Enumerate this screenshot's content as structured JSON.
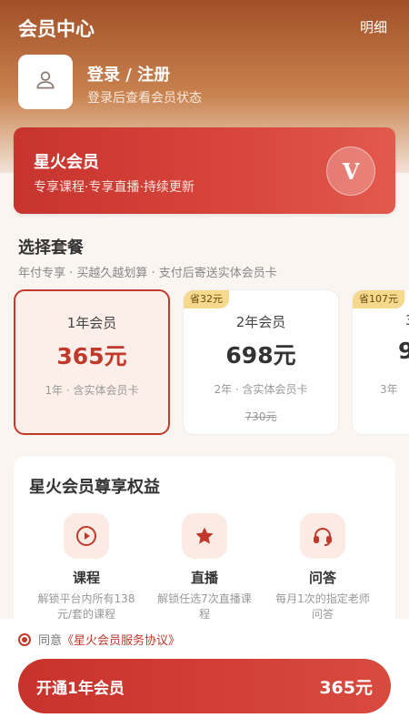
{
  "header": {
    "title": "会员中心",
    "detail_link": "明细"
  },
  "user": {
    "login_title": "登录 / 注册",
    "login_subtitle": "登录后查看会员状态"
  },
  "vip_card": {
    "title": "星火会员",
    "subtitle": "专享课程·专享直播·持续更新",
    "badge": "V"
  },
  "plans_section": {
    "title": "选择套餐",
    "subtitle": "年付专享 · 买越久越划算 · 支付后寄送实体会员卡",
    "plans": [
      {
        "name": "1年会员",
        "price": "365元",
        "desc": "1年 · 含实体会员卡",
        "save": "",
        "original": "",
        "selected": true
      },
      {
        "name": "2年会员",
        "price": "698元",
        "desc": "2年 · 含实体会员卡",
        "save": "省32元",
        "original": "730元",
        "selected": false
      },
      {
        "name": "3",
        "price": "9",
        "desc": "3年",
        "save": "省107元",
        "original": "",
        "selected": false
      }
    ]
  },
  "benefits": {
    "title": "星火会员尊享权益",
    "items": [
      {
        "name": "课程",
        "desc": "解锁平台内所有138元/套的课程",
        "icon": "play-icon"
      },
      {
        "name": "直播",
        "desc": "解锁任选7次直播课程",
        "icon": "star-icon"
      },
      {
        "name": "问答",
        "desc": "每月1次的指定老师问答",
        "icon": "headset-icon"
      }
    ]
  },
  "footer": {
    "agree_prefix": "同意",
    "agree_link": "《星火会员服务协议》",
    "buy_label": "开通1年会员",
    "buy_price": "365元"
  },
  "colors": {
    "accent": "#c0392b",
    "header_top": "#a24f27",
    "tag": "#f7d98d"
  }
}
